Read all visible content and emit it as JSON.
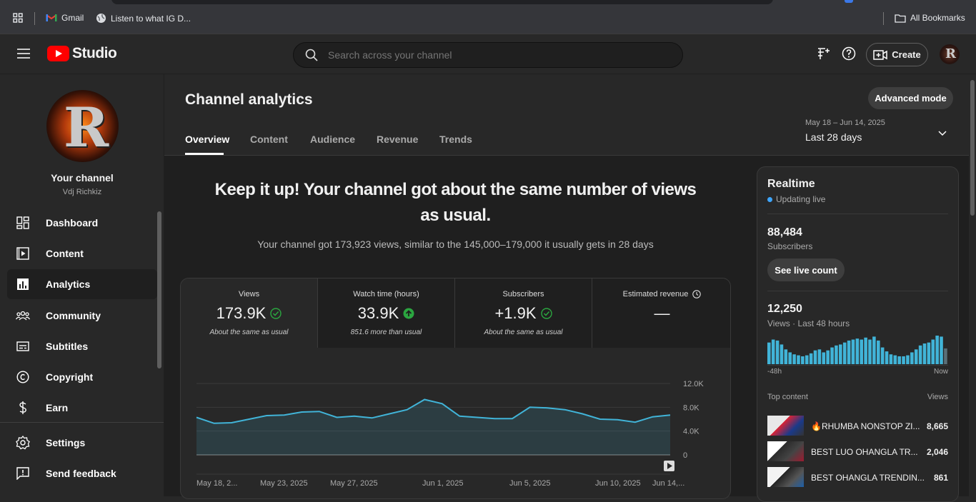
{
  "bookmarks": {
    "gmail": "Gmail",
    "listen": "Listen to what IG D...",
    "all": "All Bookmarks"
  },
  "appbar": {
    "logo_text": "Studio",
    "search_placeholder": "Search across your channel",
    "create": "Create"
  },
  "channel": {
    "title": "Your channel",
    "name": "Vdj Richkiz",
    "avatar_letter": "R"
  },
  "nav": [
    {
      "label": "Dashboard",
      "icon": "dashboard-icon"
    },
    {
      "label": "Content",
      "icon": "content-icon"
    },
    {
      "label": "Analytics",
      "icon": "analytics-icon"
    },
    {
      "label": "Community",
      "icon": "community-icon"
    },
    {
      "label": "Subtitles",
      "icon": "subtitles-icon"
    },
    {
      "label": "Copyright",
      "icon": "copyright-icon"
    },
    {
      "label": "Earn",
      "icon": "earn-icon"
    }
  ],
  "nav_bottom": [
    {
      "label": "Settings",
      "icon": "settings-icon"
    },
    {
      "label": "Send feedback",
      "icon": "feedback-icon"
    }
  ],
  "page": {
    "title": "Channel analytics",
    "advanced": "Advanced mode",
    "date_range": "May 18 – Jun 14, 2025",
    "period": "Last 28 days"
  },
  "tabs": [
    "Overview",
    "Content",
    "Audience",
    "Revenue",
    "Trends"
  ],
  "headline": {
    "line1": "Keep it up! Your channel got about the same number of views",
    "line2": "as usual.",
    "desc": "Your channel got 173,923 views, similar to the 145,000–179,000 it usually gets in 28 days"
  },
  "metrics": [
    {
      "label": "Views",
      "value": "173.9K",
      "sub": "About the same as usual"
    },
    {
      "label": "Watch time (hours)",
      "value": "33.9K",
      "sub": "851.6 more than usual"
    },
    {
      "label": "Subscribers",
      "value": "+1.9K",
      "sub": "About the same as usual"
    },
    {
      "label": "Estimated revenue",
      "value": "—",
      "sub": ""
    }
  ],
  "chart_data": {
    "type": "area",
    "y_ticks": [
      "12.0K",
      "8.0K",
      "4.0K",
      "0"
    ],
    "ylim": [
      0,
      12000
    ],
    "x_labels": [
      "May 18, 2...",
      "May 23, 2025",
      "May 27, 2025",
      "Jun 1, 2025",
      "Jun 5, 2025",
      "Jun 10, 2025",
      "Jun 14,..."
    ],
    "values": [
      6300,
      5300,
      5400,
      6000,
      6600,
      6700,
      7200,
      7300,
      6300,
      6500,
      6200,
      6900,
      7600,
      9300,
      8600,
      6500,
      6300,
      6100,
      6100,
      8000,
      7900,
      7600,
      6900,
      6000,
      5900,
      5500,
      6400,
      6700
    ],
    "color": "#41b4d8"
  },
  "realtime": {
    "title": "Realtime",
    "status": "Updating live",
    "subs_value": "88,484",
    "subs_label": "Subscribers",
    "see_live": "See live count",
    "views_value": "12,250",
    "views_label": "Views · Last 48 hours",
    "axis_start": "-48h",
    "axis_end": "Now",
    "top_content": "Top content",
    "views_col": "Views",
    "bars": [
      22,
      25,
      24,
      20,
      15,
      12,
      10,
      9,
      8,
      9,
      11,
      14,
      15,
      12,
      14,
      17,
      19,
      20,
      22,
      24,
      25,
      26,
      25,
      27,
      25,
      28,
      24,
      17,
      13,
      10,
      9,
      8,
      8,
      9,
      12,
      15,
      19,
      21,
      22,
      25,
      29,
      28,
      16
    ],
    "items": [
      {
        "title": "🔥RHUMBA NONSTOP ZI...",
        "views": "8,665"
      },
      {
        "title": "BEST LUO OHANGLA TR...",
        "views": "2,046"
      },
      {
        "title": "BEST OHANGLA TRENDIN...",
        "views": "861"
      }
    ]
  }
}
